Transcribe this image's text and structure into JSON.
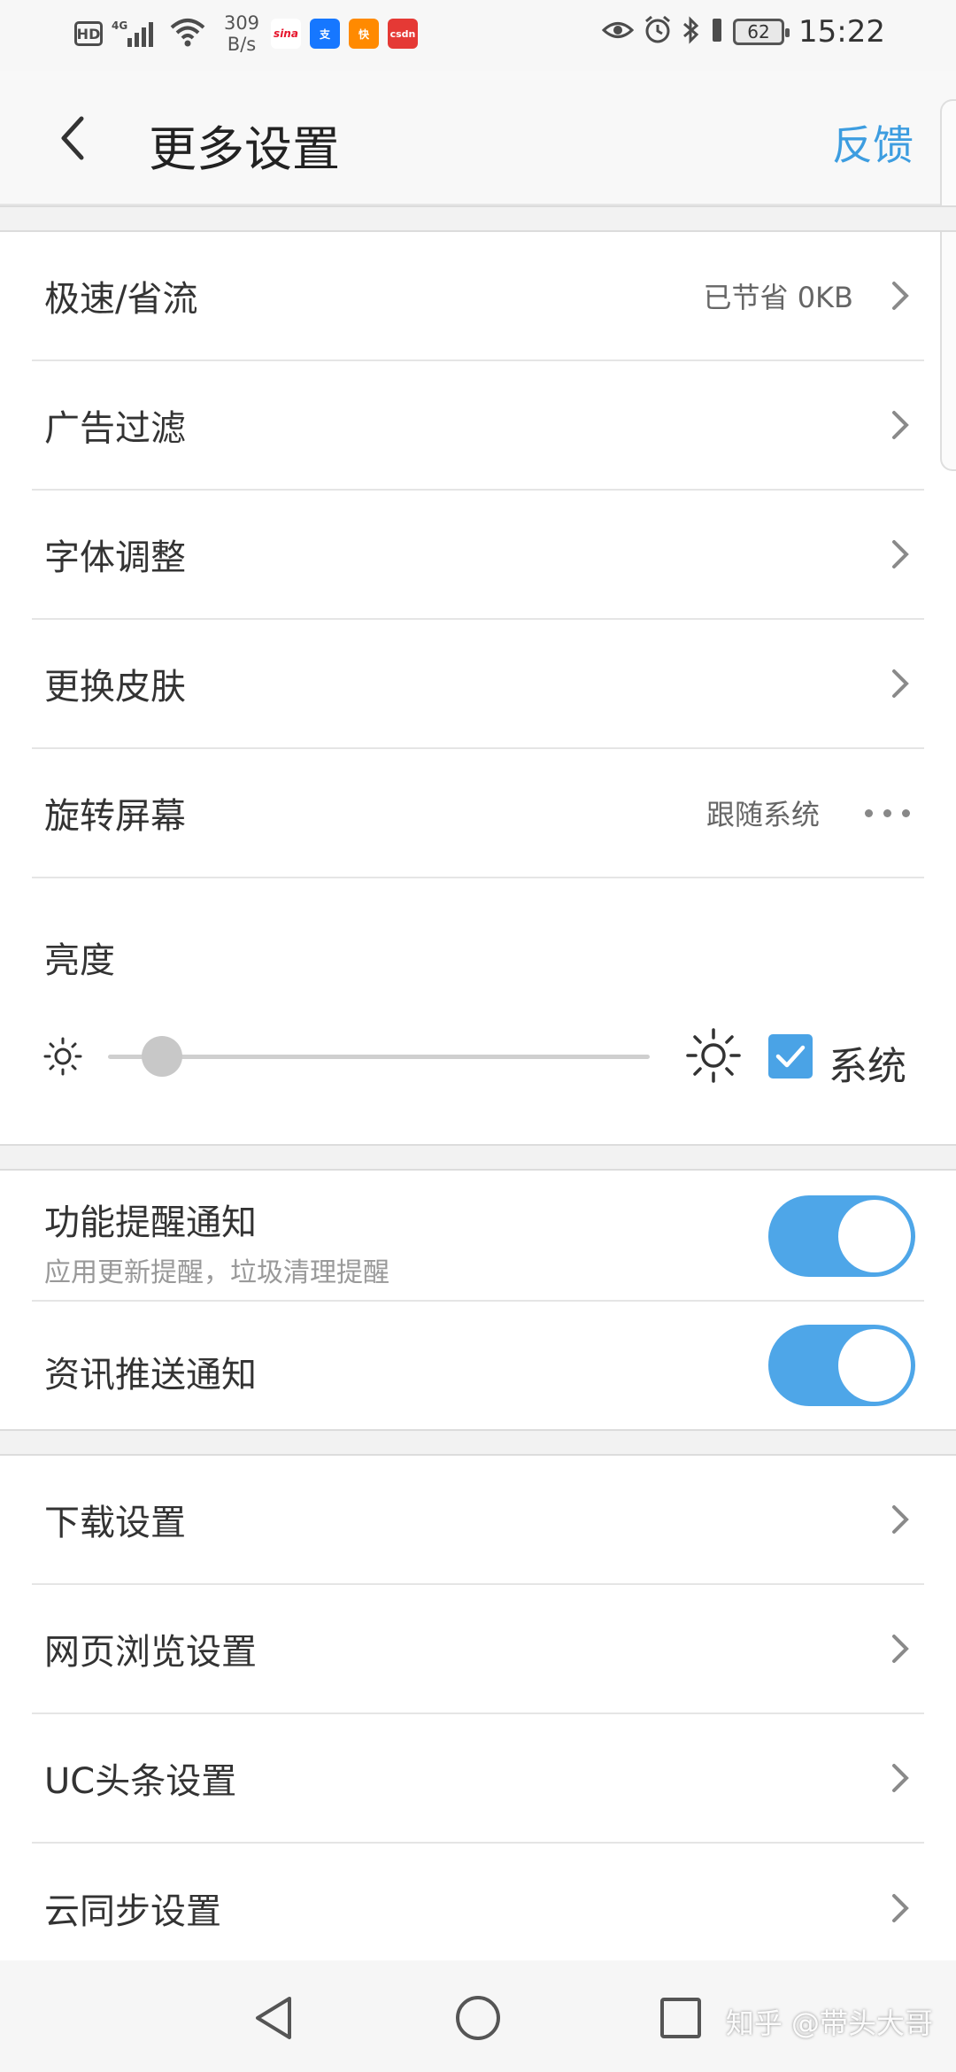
{
  "status_bar": {
    "hd": "HD",
    "network": "4G",
    "speed_value": "309",
    "speed_unit": "B/s",
    "apps": [
      {
        "name": "sina",
        "label": "sina",
        "color": "#ffffff",
        "text_color": "#e6162d"
      },
      {
        "name": "alipay",
        "label": "支",
        "color": "#1677ff",
        "text_color": "#ffffff"
      },
      {
        "name": "kuaishou",
        "label": "快",
        "color": "#ff8a00",
        "text_color": "#ffffff"
      },
      {
        "name": "csdn",
        "label": "csdn",
        "color": "#e53935",
        "text_color": "#ffffff"
      }
    ],
    "battery": "62",
    "time": "15:22"
  },
  "app_bar": {
    "title": "更多设置",
    "feedback": "反馈"
  },
  "section1": {
    "rows": [
      {
        "label": "极速/省流",
        "value": "已节省 0KB"
      },
      {
        "label": "广告过滤",
        "value": ""
      },
      {
        "label": "字体调整",
        "value": ""
      },
      {
        "label": "更换皮肤",
        "value": ""
      },
      {
        "label": "旋转屏幕",
        "value": "跟随系统"
      }
    ]
  },
  "brightness": {
    "label": "亮度",
    "level": 0.1,
    "system_checked": true,
    "system_label": "系统"
  },
  "notifications": {
    "items": [
      {
        "title": "功能提醒通知",
        "subtitle": "应用更新提醒，垃圾清理提醒",
        "enabled": true
      },
      {
        "title": "资讯推送通知",
        "subtitle": "",
        "enabled": true
      }
    ]
  },
  "section3": {
    "rows": [
      {
        "label": "下载设置"
      },
      {
        "label": "网页浏览设置"
      },
      {
        "label": "UC头条设置"
      },
      {
        "label": "云同步设置"
      }
    ]
  },
  "watermark": "知乎 @带头大哥",
  "colors": {
    "accent": "#4ea6e8",
    "feedback": "#3d9de0"
  }
}
